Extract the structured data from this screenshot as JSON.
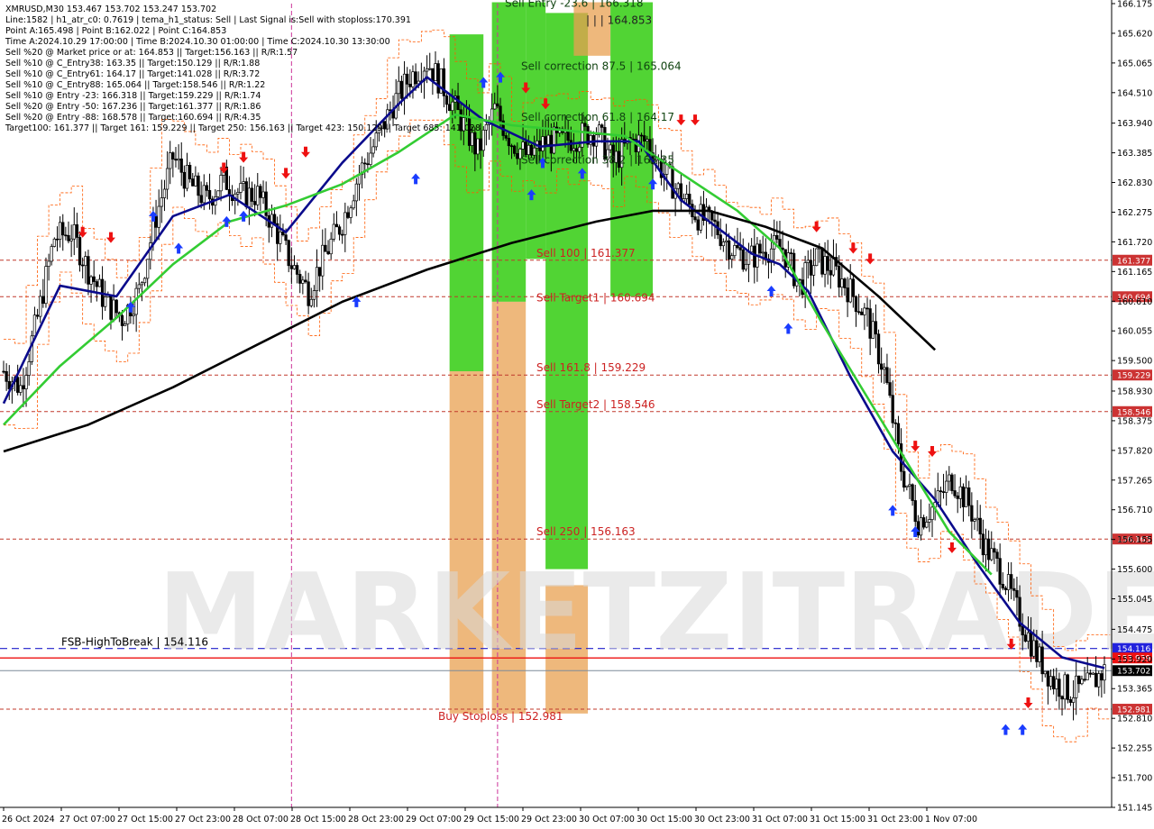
{
  "header": {
    "lines": [
      "XMRUSD,M30  153.467 153.702 153.247 153.702",
      "Line:1582 | h1_atr_c0: 0.7619 | tema_h1_status: Sell | Last Signal is:Sell with stoploss:170.391",
      "Point A:165.498 | Point B:162.022 | Point C:164.853",
      "Time A:2024.10.29 17:00:00 | Time B:2024.10.30 01:00:00 | Time C:2024.10.30 13:30:00",
      "Sell %20 @ Market price or at: 164.853 || Target:156.163 || R/R:1.57",
      "Sell %10 @ C_Entry38: 163.35 || Target:150.129 || R/R:1.88",
      "Sell %10 @ C_Entry61: 164.17 || Target:141.028 || R/R:3.72",
      "Sell %10 @ C_Entry88: 165.064 || Target:158.546 || R/R:1.22",
      "Sell %10 @ Entry -23: 166.318 || Target:159.229 || R/R:1.74",
      "Sell %20 @ Entry -50: 167.236 || Target:161.377 || R/R:1.86",
      "Sell %20 @ Entry -88: 168.578 || Target:160.694 || R/R:4.35",
      "Target100: 161.377 || Target 161: 159.229 || Target 250: 156.163 || Target 423: 150.129 || Target 685: 141.028"
    ]
  },
  "watermark": "MARKETZITRADE",
  "colors": {
    "bg": "#ffffff",
    "candle": "#000000",
    "fast_ma": "#0a0a8c",
    "mid_ma": "#33cc33",
    "slow_ma": "#000000",
    "level_red": "#c0392b",
    "level_blue": "#1f1fcc",
    "zone_green": "#33cc11",
    "zone_orange": "#e8a050",
    "buy_arrow": "#1a3cff",
    "sell_arrow": "#ee1111"
  },
  "chart_data": {
    "type": "candlestick",
    "symbol": "XMRUSD",
    "timeframe": "M30",
    "ylim": [
      151.145,
      166.175
    ],
    "y_ticks": [
      "166.175",
      "165.620",
      "165.065",
      "164.510",
      "163.940",
      "163.385",
      "162.830",
      "162.275",
      "161.720",
      "161.165",
      "160.610",
      "160.055",
      "159.500",
      "158.930",
      "158.375",
      "157.820",
      "157.265",
      "156.710",
      "156.155",
      "155.600",
      "155.045",
      "154.475",
      "153.920",
      "153.365",
      "152.810",
      "152.255",
      "151.700",
      "151.145"
    ],
    "x_ticks": [
      "26 Oct 2024",
      "27 Oct 07:00",
      "27 Oct 15:00",
      "27 Oct 23:00",
      "28 Oct 07:00",
      "28 Oct 15:00",
      "28 Oct 23:00",
      "29 Oct 07:00",
      "29 Oct 15:00",
      "29 Oct 23:00",
      "30 Oct 07:00",
      "30 Oct 15:00",
      "30 Oct 23:00",
      "31 Oct 07:00",
      "31 Oct 15:00",
      "31 Oct 23:00",
      "1 Nov 07:00"
    ],
    "close_path": [
      [
        0,
        159.3
      ],
      [
        6,
        159.0
      ],
      [
        12,
        160.3
      ],
      [
        18,
        161.8
      ],
      [
        24,
        161.9
      ],
      [
        30,
        161.2
      ],
      [
        36,
        160.6
      ],
      [
        42,
        160.3
      ],
      [
        48,
        160.8
      ],
      [
        54,
        162.2
      ],
      [
        60,
        163.3
      ],
      [
        66,
        162.8
      ],
      [
        72,
        162.5
      ],
      [
        78,
        162.9
      ],
      [
        84,
        162.6
      ],
      [
        90,
        162.6
      ],
      [
        96,
        162.0
      ],
      [
        102,
        161.3
      ],
      [
        108,
        160.8
      ],
      [
        114,
        161.5
      ],
      [
        120,
        162.1
      ],
      [
        126,
        163.0
      ],
      [
        132,
        163.6
      ],
      [
        138,
        164.3
      ],
      [
        144,
        164.8
      ],
      [
        150,
        165.1
      ],
      [
        156,
        164.6
      ],
      [
        162,
        164.0
      ],
      [
        168,
        163.4
      ],
      [
        174,
        164.2
      ],
      [
        180,
        163.6
      ],
      [
        186,
        163.3
      ],
      [
        192,
        163.6
      ],
      [
        198,
        163.6
      ],
      [
        204,
        163.7
      ],
      [
        210,
        163.8
      ],
      [
        216,
        163.2
      ],
      [
        222,
        163.6
      ],
      [
        228,
        163.6
      ],
      [
        234,
        163.0
      ],
      [
        240,
        162.6
      ],
      [
        246,
        162.2
      ],
      [
        252,
        162.0
      ],
      [
        258,
        161.6
      ],
      [
        264,
        161.4
      ],
      [
        270,
        161.6
      ],
      [
        276,
        161.6
      ],
      [
        282,
        160.9
      ],
      [
        288,
        161.4
      ],
      [
        294,
        161.2
      ],
      [
        300,
        160.8
      ],
      [
        306,
        160.3
      ],
      [
        312,
        159.3
      ],
      [
        318,
        157.5
      ],
      [
        324,
        156.5
      ],
      [
        330,
        156.8
      ],
      [
        336,
        157.3
      ],
      [
        342,
        156.8
      ],
      [
        348,
        156.0
      ],
      [
        354,
        155.5
      ],
      [
        360,
        154.7
      ],
      [
        366,
        154.0
      ],
      [
        372,
        153.5
      ],
      [
        378,
        153.3
      ],
      [
        384,
        153.4
      ],
      [
        390,
        153.702
      ]
    ],
    "series": [
      {
        "style": "fast-ma",
        "points": [
          [
            0,
            158.7
          ],
          [
            20,
            160.9
          ],
          [
            40,
            160.7
          ],
          [
            60,
            162.2
          ],
          [
            80,
            162.6
          ],
          [
            100,
            161.9
          ],
          [
            120,
            163.2
          ],
          [
            140,
            164.3
          ],
          [
            150,
            164.8
          ],
          [
            170,
            164.0
          ],
          [
            190,
            163.5
          ],
          [
            210,
            163.6
          ],
          [
            225,
            163.6
          ],
          [
            240,
            162.5
          ],
          [
            255,
            161.9
          ],
          [
            265,
            161.5
          ],
          [
            275,
            161.3
          ],
          [
            285,
            160.8
          ],
          [
            300,
            159.2
          ],
          [
            315,
            157.8
          ],
          [
            330,
            156.9
          ],
          [
            345,
            155.7
          ],
          [
            360,
            154.6
          ],
          [
            375,
            153.95
          ],
          [
            390,
            153.75
          ]
        ]
      },
      {
        "style": "mid-ma",
        "points": [
          [
            0,
            158.3
          ],
          [
            20,
            159.4
          ],
          [
            40,
            160.3
          ],
          [
            60,
            161.3
          ],
          [
            80,
            162.1
          ],
          [
            100,
            162.4
          ],
          [
            120,
            162.8
          ],
          [
            140,
            163.4
          ],
          [
            160,
            164.1
          ],
          [
            180,
            163.9
          ],
          [
            200,
            163.8
          ],
          [
            220,
            163.7
          ],
          [
            240,
            163.0
          ],
          [
            260,
            162.3
          ],
          [
            275,
            161.6
          ],
          [
            290,
            160.2
          ],
          [
            305,
            158.9
          ],
          [
            320,
            157.6
          ],
          [
            335,
            156.3
          ],
          [
            350,
            155.5
          ]
        ]
      },
      {
        "style": "slow-ma",
        "points": [
          [
            0,
            157.8
          ],
          [
            30,
            158.3
          ],
          [
            60,
            159.0
          ],
          [
            90,
            159.8
          ],
          [
            120,
            160.6
          ],
          [
            150,
            161.2
          ],
          [
            180,
            161.7
          ],
          [
            210,
            162.1
          ],
          [
            230,
            162.3
          ],
          [
            250,
            162.3
          ],
          [
            270,
            162.0
          ],
          [
            290,
            161.6
          ],
          [
            310,
            160.7
          ],
          [
            330,
            159.7
          ]
        ]
      }
    ],
    "levels": [
      {
        "label": "Sell 100 | 161.377",
        "price": 161.377,
        "badge": "161.377",
        "style": "red-dash"
      },
      {
        "label": "Sell Target1 | 160.694",
        "price": 160.694,
        "badge": "160.694",
        "style": "red-dash"
      },
      {
        "label": "Sell 161.8 | 159.229",
        "price": 159.229,
        "badge": "159.229",
        "style": "red-dash"
      },
      {
        "label": "Sell Target2 | 158.546",
        "price": 158.546,
        "badge": "158.546",
        "style": "red-dash"
      },
      {
        "label": "Sell 250 | 156.163",
        "price": 156.163,
        "badge": "156.163",
        "style": "red-dash"
      },
      {
        "label": "FSB-HighToBreak | 154.116",
        "price": 154.116,
        "badge": "154.116",
        "style": "blue-dash"
      },
      {
        "label": "",
        "price": 153.939,
        "badge": "153.939",
        "style": "red-solid"
      },
      {
        "label": "",
        "price": 153.702,
        "badge": "153.702",
        "style": "current"
      },
      {
        "label": "Buy Stoploss | 152.981",
        "price": 152.981,
        "badge": "152.981",
        "style": "red-dash"
      }
    ],
    "zone_labels": [
      {
        "text": "Sell Entry -23.6 | 166.318",
        "price": 166.18
      },
      {
        "text": "| | | 164.853",
        "price": 165.86
      },
      {
        "text": "Sell correction 87.5 | 165.064",
        "price": 165.0
      },
      {
        "text": "Sell correction 61.8 | 164.17",
        "price": 164.05
      },
      {
        "text": "Sell correction 38.2 | 163.35",
        "price": 163.25
      }
    ],
    "zones": [
      {
        "x0": 158,
        "x1": 170,
        "p0": 159.3,
        "p1": 165.6,
        "kind": "green"
      },
      {
        "x0": 158,
        "x1": 170,
        "p0": 152.9,
        "p1": 159.3,
        "kind": "orange"
      },
      {
        "x0": 173,
        "x1": 185,
        "p0": 160.6,
        "p1": 166.2,
        "kind": "green"
      },
      {
        "x0": 173,
        "x1": 185,
        "p0": 152.9,
        "p1": 160.6,
        "kind": "orange"
      },
      {
        "x0": 185,
        "x1": 192,
        "p0": 161.4,
        "p1": 166.2,
        "kind": "green"
      },
      {
        "x0": 192,
        "x1": 207,
        "p0": 155.6,
        "p1": 166.0,
        "kind": "green"
      },
      {
        "x0": 192,
        "x1": 207,
        "p0": 152.9,
        "p1": 155.3,
        "kind": "orange"
      },
      {
        "x0": 202,
        "x1": 215,
        "p0": 165.2,
        "p1": 166.2,
        "kind": "orange"
      },
      {
        "x0": 215,
        "x1": 230,
        "p0": 160.7,
        "p1": 166.2,
        "kind": "green"
      }
    ],
    "buy_arrows": [
      [
        45,
        160.5
      ],
      [
        53,
        162.2
      ],
      [
        62,
        161.6
      ],
      [
        79,
        162.1
      ],
      [
        85,
        162.2
      ],
      [
        125,
        160.6
      ],
      [
        146,
        162.9
      ],
      [
        170,
        164.7
      ],
      [
        176,
        164.8
      ],
      [
        187,
        162.6
      ],
      [
        191,
        163.2
      ],
      [
        205,
        163.0
      ],
      [
        230,
        162.8
      ],
      [
        272,
        160.8
      ],
      [
        278,
        160.1
      ],
      [
        315,
        156.7
      ],
      [
        323,
        156.3
      ],
      [
        355,
        152.6
      ],
      [
        361,
        152.6
      ]
    ],
    "sell_arrows": [
      [
        28,
        161.9
      ],
      [
        38,
        161.8
      ],
      [
        78,
        163.1
      ],
      [
        85,
        163.3
      ],
      [
        100,
        163.0
      ],
      [
        107,
        163.4
      ],
      [
        185,
        164.6
      ],
      [
        192,
        164.3
      ],
      [
        240,
        164.0
      ],
      [
        245,
        164.0
      ],
      [
        288,
        162.0
      ],
      [
        301,
        161.6
      ],
      [
        307,
        161.4
      ],
      [
        323,
        157.9
      ],
      [
        329,
        157.8
      ],
      [
        336,
        156.0
      ],
      [
        357,
        154.2
      ],
      [
        363,
        153.1
      ]
    ]
  }
}
